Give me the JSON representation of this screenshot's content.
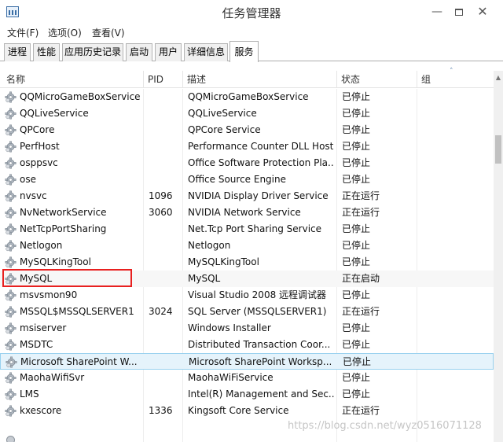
{
  "window": {
    "title": "任务管理器",
    "min": "—",
    "close": "✕"
  },
  "menu": [
    {
      "label": "文件(F)"
    },
    {
      "label": "选项(O)"
    },
    {
      "label": "查看(V)"
    }
  ],
  "tabs": [
    {
      "label": "进程"
    },
    {
      "label": "性能"
    },
    {
      "label": "应用历史记录"
    },
    {
      "label": "启动"
    },
    {
      "label": "用户"
    },
    {
      "label": "详细信息"
    },
    {
      "label": "服务",
      "active": true
    }
  ],
  "columns": {
    "name": "名称",
    "pid": "PID",
    "desc": "描述",
    "status": "状态",
    "group": "组"
  },
  "sort_indicator": "˄",
  "rows": [
    {
      "name": "QQMicroGameBoxService",
      "pid": "",
      "desc": "QQMicroGameBoxService",
      "status": "已停止"
    },
    {
      "name": "QQLiveService",
      "pid": "",
      "desc": "QQLiveService",
      "status": "已停止"
    },
    {
      "name": "QPCore",
      "pid": "",
      "desc": "QPCore Service",
      "status": "已停止"
    },
    {
      "name": "PerfHost",
      "pid": "",
      "desc": "Performance Counter DLL Host",
      "status": "已停止"
    },
    {
      "name": "osppsvc",
      "pid": "",
      "desc": "Office Software Protection Pla...",
      "status": "已停止"
    },
    {
      "name": "ose",
      "pid": "",
      "desc": "Office  Source Engine",
      "status": "已停止"
    },
    {
      "name": "nvsvc",
      "pid": "1096",
      "desc": "NVIDIA Display Driver Service",
      "status": "正在运行"
    },
    {
      "name": "NvNetworkService",
      "pid": "3060",
      "desc": "NVIDIA Network Service",
      "status": "正在运行"
    },
    {
      "name": "NetTcpPortSharing",
      "pid": "",
      "desc": "Net.Tcp Port Sharing Service",
      "status": "已停止"
    },
    {
      "name": "Netlogon",
      "pid": "",
      "desc": "Netlogon",
      "status": "已停止"
    },
    {
      "name": "MySQLKingTool",
      "pid": "",
      "desc": "MySQLKingTool",
      "status": "已停止"
    },
    {
      "name": "MySQL",
      "pid": "",
      "desc": "MySQL",
      "status": "正在启动",
      "state": "hover"
    },
    {
      "name": "msvsmon90",
      "pid": "",
      "desc": "Visual Studio 2008 远程调试器",
      "status": "已停止"
    },
    {
      "name": "MSSQL$MSSQLSERVER1",
      "pid": "3024",
      "desc": "SQL Server (MSSQLSERVER1)",
      "status": "正在运行"
    },
    {
      "name": "msiserver",
      "pid": "",
      "desc": "Windows Installer",
      "status": "已停止"
    },
    {
      "name": "MSDTC",
      "pid": "",
      "desc": "Distributed Transaction Coor...",
      "status": "已停止"
    },
    {
      "name": "Microsoft SharePoint W...",
      "pid": "",
      "desc": "Microsoft SharePoint Worksp...",
      "status": "已停止",
      "state": "selected"
    },
    {
      "name": "MaohaWifiSvr",
      "pid": "",
      "desc": "MaohaWiFiService",
      "status": "已停止"
    },
    {
      "name": "LMS",
      "pid": "",
      "desc": "Intel(R) Management and Sec...",
      "status": "已停止"
    },
    {
      "name": "kxescore",
      "pid": "1336",
      "desc": "Kingsoft Core Service",
      "status": "正在运行"
    }
  ],
  "watermark": "https://blog.csdn.net/wyz0516071128"
}
